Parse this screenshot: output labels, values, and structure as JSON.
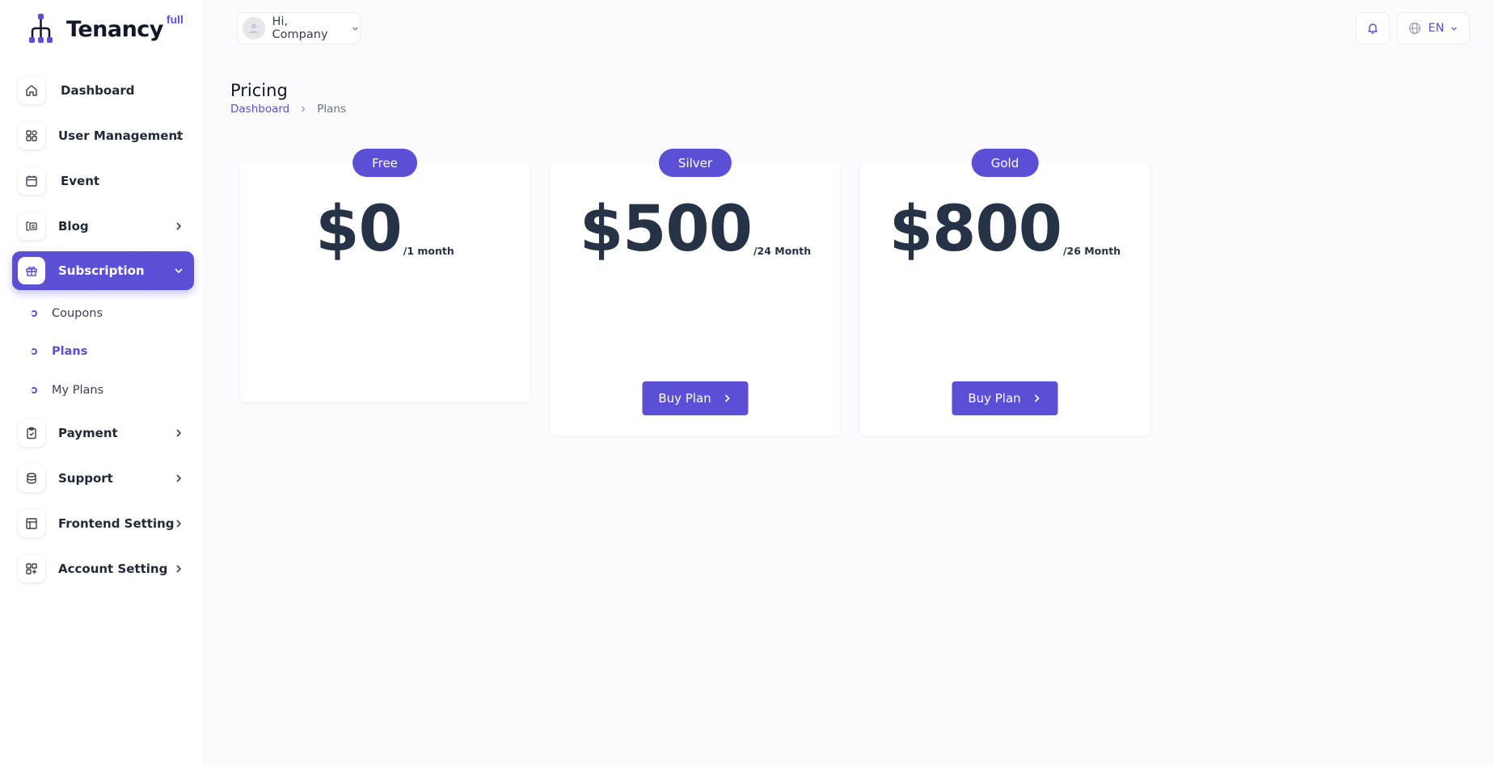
{
  "app": {
    "logo_text": "Tenancy",
    "logo_sup": "full"
  },
  "sidebar": {
    "items": [
      {
        "label": "Dashboard",
        "icon": "home-icon",
        "has_chevron": false
      },
      {
        "label": "User Management",
        "icon": "grid-icon",
        "has_chevron": true
      },
      {
        "label": "Event",
        "icon": "calendar-icon",
        "has_chevron": false
      },
      {
        "label": "Blog",
        "icon": "blog-icon",
        "has_chevron": true
      },
      {
        "label": "Subscription",
        "icon": "gift-icon",
        "has_chevron": true,
        "active": true
      },
      {
        "label": "Payment",
        "icon": "clipboard-icon",
        "has_chevron": true
      },
      {
        "label": "Support",
        "icon": "database-icon",
        "has_chevron": true
      },
      {
        "label": "Frontend Setting",
        "icon": "layout-icon",
        "has_chevron": true
      },
      {
        "label": "Account Setting",
        "icon": "apps-add-icon",
        "has_chevron": true
      }
    ],
    "sub_items": [
      {
        "label": "Coupons"
      },
      {
        "label": "Plans",
        "active": true
      },
      {
        "label": "My Plans"
      }
    ]
  },
  "topbar": {
    "greeting": "Hi, Company",
    "language": "EN"
  },
  "header": {
    "title": "Pricing",
    "breadcrumb": {
      "home": "Dashboard",
      "current": "Plans"
    }
  },
  "plans": [
    {
      "name": "Free",
      "price": "$0",
      "period": "/1 month",
      "button": null
    },
    {
      "name": "Silver",
      "price": "$500",
      "period": "/24 Month",
      "button": "Buy Plan"
    },
    {
      "name": "Gold",
      "price": "$800",
      "period": "/26 Month",
      "button": "Buy Plan"
    }
  ],
  "colors": {
    "accent": "#5b4fd5",
    "price_text": "#263246",
    "background": "#fbfbfd"
  }
}
